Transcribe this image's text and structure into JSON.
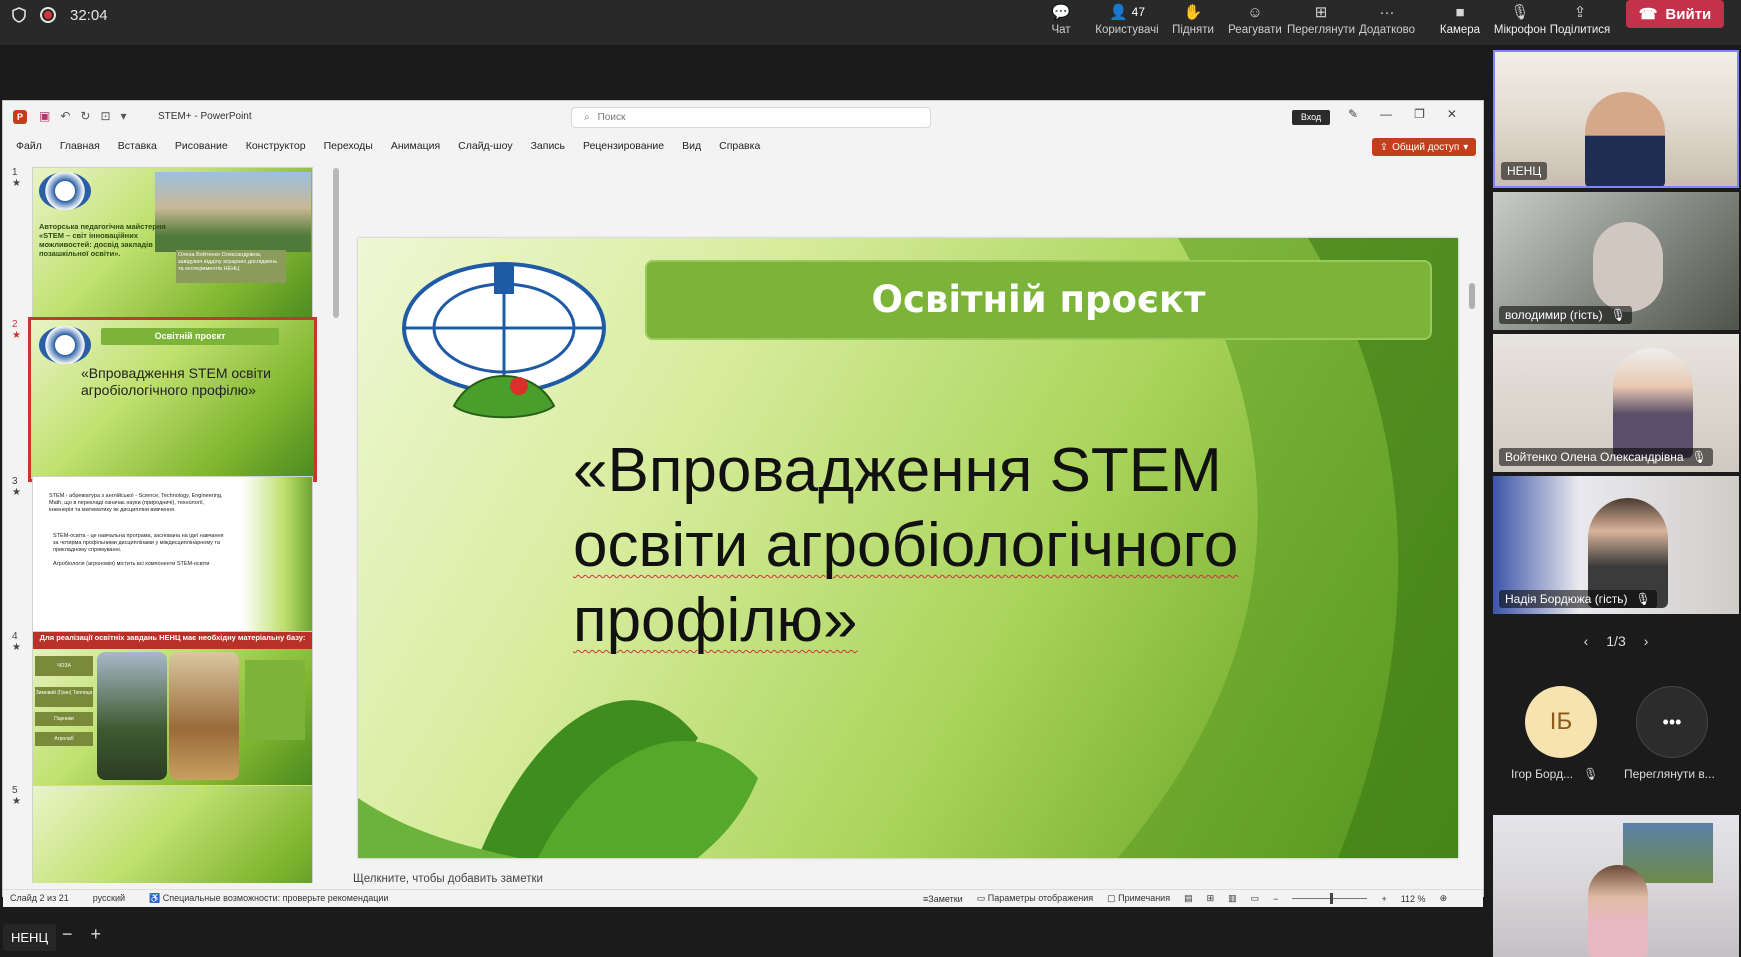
{
  "meeting": {
    "timer": "32:04",
    "tools": [
      {
        "label": "Чат",
        "icon": "chat-icon",
        "count": ""
      },
      {
        "label": "Користувачі",
        "icon": "people-icon",
        "count": "47"
      },
      {
        "label": "Підняти",
        "icon": "raise-hand-icon",
        "count": ""
      },
      {
        "label": "Реагувати",
        "icon": "react-icon",
        "count": ""
      },
      {
        "label": "Переглянути",
        "icon": "view-icon",
        "count": ""
      },
      {
        "label": "Додатково",
        "icon": "more-icon",
        "count": ""
      }
    ],
    "media": [
      {
        "label": "Камера",
        "icon": "camera-icon"
      },
      {
        "label": "Мікрофон",
        "icon": "mic-off-icon"
      },
      {
        "label": "Поділитися",
        "icon": "share-icon"
      }
    ],
    "leave_label": "Вийти",
    "presenter_name": "НЕНЦ",
    "zoom_minus": "−",
    "zoom_plus": "+"
  },
  "ppt": {
    "doc_title": "STEM+  -  PowerPoint",
    "search_placeholder": "Поиск",
    "signin_label": "Вход",
    "menu": [
      "Файл",
      "Главная",
      "Вставка",
      "Рисование",
      "Конструктор",
      "Переходы",
      "Анимация",
      "Слайд-шоу",
      "Запись",
      "Рецензирование",
      "Вид",
      "Справка"
    ],
    "share_label": "Общий доступ",
    "notes_placeholder": "Щелкните, чтобы добавить заметки",
    "status": {
      "slide_counter": "Слайд 2 из 21",
      "language": "русский",
      "accessibility": "Специальные возможности: проверьте рекомендации",
      "notes": "Заметки",
      "display_settings": "Параметры отображения",
      "comments": "Примечания",
      "zoom": "112 %"
    },
    "thumbnails": [
      {
        "num": "1",
        "text": "Авторська педагогічна майстерня «STEM – світ інноваційних можливостей: досвід закладів позашкільної освіти».",
        "caption": "Олена Войтенко Олександрівна, завідувач відділу аграрних досліджень та експериментів НЕНЦ"
      },
      {
        "num": "2",
        "banner": "Освітній проєкт",
        "text": "«Впровадження STEM освіти агробіологічного профілю»"
      },
      {
        "num": "3",
        "text": "STEM - абревіатура з англійської - Science, Technology, Engineering, Math, що в перекладі означає науки (природничі), технології, інженерія та математику як дисципліни вивчення.",
        "bullets": [
          "STEM-освіта - це навчальна програма, заснована на ідеї навчання за чотирма профільними дисциплінами у міждисциплінарному та прикладному спрямуванні.",
          "Агробіологія (агрономія) містить всі компоненти STEM-освіти"
        ]
      },
      {
        "num": "4",
        "banner": "Для реалізації освітніх завдань НЕНЦ має необхідну матеріальну базу:",
        "labels": [
          "ЧОЗА",
          "Зимовий (Грин) Теплиця",
          "Парники",
          "Агролаб"
        ]
      },
      {
        "num": "5"
      }
    ],
    "slide": {
      "banner": "Освітній проєкт",
      "heading_lines": [
        "«Впровадження STEM",
        "освіти агробіологічного",
        "профілю»"
      ]
    }
  },
  "participants": [
    {
      "name": "НЕНЦ",
      "muted": false
    },
    {
      "name": "володимир (гість)",
      "muted": true
    },
    {
      "name": "Войтенко Олена Олександрівна",
      "muted": true
    },
    {
      "name": "Надія Бордюжа (гість)",
      "muted": true
    }
  ],
  "pager": "1/3",
  "avatars": [
    {
      "initials": "ІБ",
      "label": "Ігор Борд...",
      "muted": true
    },
    {
      "initials": "•••",
      "label": "Переглянути в..."
    }
  ],
  "colors": {
    "leave": "#c4314b",
    "ppt_accent": "#c43e1c",
    "active_speaker": "#7f85f5",
    "avatar_bg": "#f7e3b0"
  }
}
